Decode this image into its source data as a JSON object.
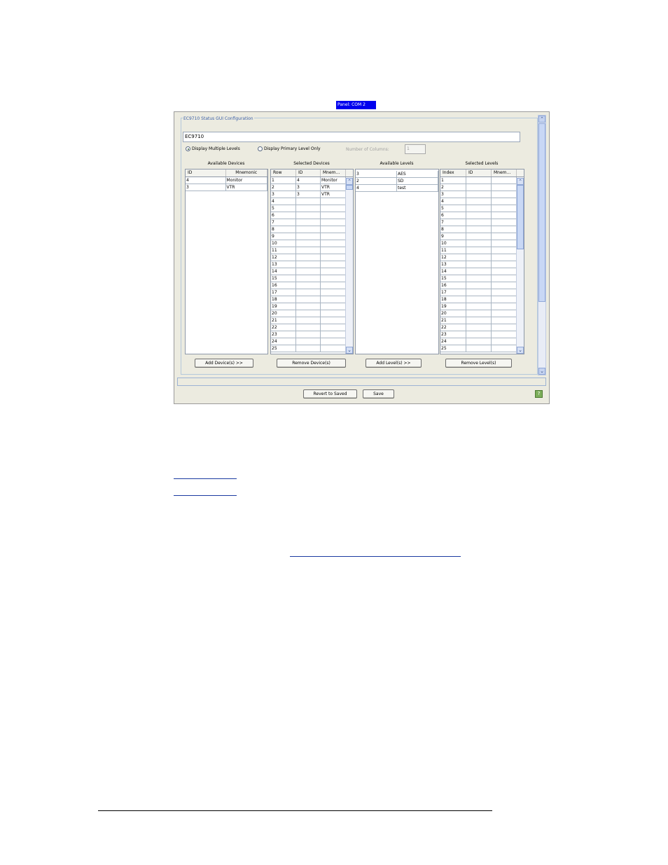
{
  "panel_tab": "Panel: COM 2",
  "config": {
    "group_title": "EC9710 Status GUI Configuration",
    "name_value": "EC9710",
    "options": {
      "multiple": "Display Multiple Levels",
      "primary": "Display Primary Level Only",
      "selected": "multiple"
    },
    "columns_label": "Number of Columns:",
    "columns_value": "1"
  },
  "available_devices": {
    "title": "Available Devices",
    "headers": [
      "ID",
      "Mnemonic"
    ],
    "rows": [
      [
        "4",
        "Monitor"
      ],
      [
        "3",
        "VTR"
      ]
    ]
  },
  "selected_devices": {
    "title": "Selected Devices",
    "headers": [
      "Row",
      "ID",
      "Mnem..."
    ],
    "rows": [
      [
        "1",
        "4",
        "Monitor"
      ],
      [
        "2",
        "3",
        "VTR"
      ],
      [
        "3",
        "3",
        "VTR"
      ],
      [
        "4",
        "",
        ""
      ],
      [
        "5",
        "",
        ""
      ],
      [
        "6",
        "",
        ""
      ],
      [
        "7",
        "",
        ""
      ],
      [
        "8",
        "",
        ""
      ],
      [
        "9",
        "",
        ""
      ],
      [
        "10",
        "",
        ""
      ],
      [
        "11",
        "",
        ""
      ],
      [
        "12",
        "",
        ""
      ],
      [
        "13",
        "",
        ""
      ],
      [
        "14",
        "",
        ""
      ],
      [
        "15",
        "",
        ""
      ],
      [
        "16",
        "",
        ""
      ],
      [
        "17",
        "",
        ""
      ],
      [
        "18",
        "",
        ""
      ],
      [
        "19",
        "",
        ""
      ],
      [
        "20",
        "",
        ""
      ],
      [
        "21",
        "",
        ""
      ],
      [
        "22",
        "",
        ""
      ],
      [
        "23",
        "",
        ""
      ],
      [
        "24",
        "",
        ""
      ],
      [
        "25",
        "",
        ""
      ]
    ]
  },
  "available_levels": {
    "title": "Available Levels",
    "rows": [
      [
        "3",
        "AES"
      ],
      [
        "2",
        "SD"
      ],
      [
        "4",
        "test"
      ]
    ]
  },
  "selected_levels": {
    "title": "Selected Levels",
    "headers": [
      "Index",
      "ID",
      "Mnem..."
    ],
    "rows": [
      [
        "1",
        "",
        ""
      ],
      [
        "2",
        "",
        ""
      ],
      [
        "3",
        "",
        ""
      ],
      [
        "4",
        "",
        ""
      ],
      [
        "5",
        "",
        ""
      ],
      [
        "6",
        "",
        ""
      ],
      [
        "7",
        "",
        ""
      ],
      [
        "8",
        "",
        ""
      ],
      [
        "9",
        "",
        ""
      ],
      [
        "10",
        "",
        ""
      ],
      [
        "11",
        "",
        ""
      ],
      [
        "12",
        "",
        ""
      ],
      [
        "13",
        "",
        ""
      ],
      [
        "14",
        "",
        ""
      ],
      [
        "15",
        "",
        ""
      ],
      [
        "16",
        "",
        ""
      ],
      [
        "17",
        "",
        ""
      ],
      [
        "18",
        "",
        ""
      ],
      [
        "19",
        "",
        ""
      ],
      [
        "20",
        "",
        ""
      ],
      [
        "21",
        "",
        ""
      ],
      [
        "22",
        "",
        ""
      ],
      [
        "23",
        "",
        ""
      ],
      [
        "24",
        "",
        ""
      ],
      [
        "25",
        "",
        ""
      ]
    ]
  },
  "buttons": {
    "add_devices": "Add Device(s) >>",
    "remove_devices": "Remove Device(s)",
    "add_levels": "Add Level(s) >>",
    "remove_levels": "Remove Level(s)",
    "revert": "Revert to Saved",
    "save": "Save"
  },
  "icons": {
    "scroll_up": "scroll-up-arrow-icon",
    "scroll_down": "scroll-down-arrow-icon",
    "help": "help-icon"
  }
}
